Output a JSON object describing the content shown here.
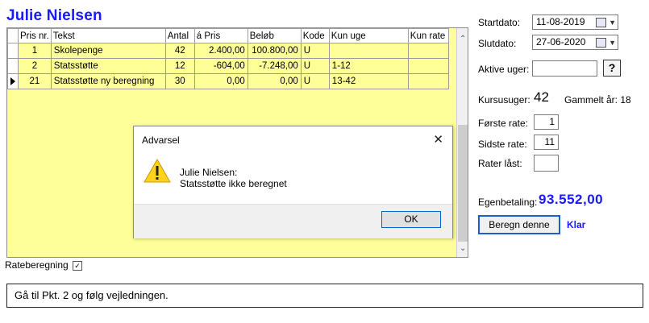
{
  "app": {
    "student_name": "Julie Nielsen",
    "columns": [
      "Pris nr.",
      "Tekst",
      "Antal",
      "á Pris",
      "Beløb",
      "Kode",
      "Kun uge",
      "Kun rate"
    ],
    "rows": [
      {
        "pris_nr": "1",
        "tekst": "Skolepenge",
        "antal": "42",
        "a_pris": "2.400,00",
        "beloeb": "100.800,00",
        "kode": "U",
        "kun_uge": "",
        "kun_rate": "",
        "selected": false
      },
      {
        "pris_nr": "2",
        "tekst": "Statsstøtte",
        "antal": "12",
        "a_pris": "-604,00",
        "beloeb": "-7.248,00",
        "kode": "U",
        "kun_uge": "1-12",
        "kun_rate": "",
        "selected": false
      },
      {
        "pris_nr": "21",
        "tekst": "Statsstøtte ny beregning",
        "antal": "30",
        "a_pris": "0,00",
        "beloeb": "0,00",
        "kode": "U",
        "kun_uge": "13-42",
        "kun_rate": "",
        "selected": true
      }
    ],
    "bottom_checkbox_label": "Rateberegning",
    "bottom_checkbox_checked": true
  },
  "right_panel": {
    "startdato_label": "Startdato:",
    "startdato_value": "11-08-2019",
    "slutdato_label": "Slutdato:",
    "slutdato_value": "27-06-2020",
    "aktive_uger_label": "Aktive uger:",
    "aktive_uger_value": "",
    "help_button_label": "?",
    "kursusuger_label": "Kursusuger:",
    "kursusuger_value": "42",
    "gammelt_aar_label": "Gammelt år: 18",
    "foerste_rate_label": "Første rate:",
    "foerste_rate_value": "1",
    "sidste_rate_label": "Sidste rate:",
    "sidste_rate_value": "11",
    "rater_laast_label": "Rater låst:",
    "rater_laast_value": "",
    "egenbetaling_label": "Egenbetaling:",
    "egenbetaling_value": "93.552,00",
    "beregn_button_label": "Beregn denne",
    "status_text": "Klar"
  },
  "dialog": {
    "title": "Advarsel",
    "close_glyph": "✕",
    "message_line1": "Julie Nielsen:",
    "message_line2": "Statsstøtte ikke beregnet",
    "ok_label": "OK",
    "icon": "warning-icon"
  },
  "instruction": {
    "text": "Gå til Pkt. 2 og følg vejledningen."
  },
  "colors": {
    "grid_background": "#ffff99",
    "accent_blue": "#1a1aff"
  }
}
